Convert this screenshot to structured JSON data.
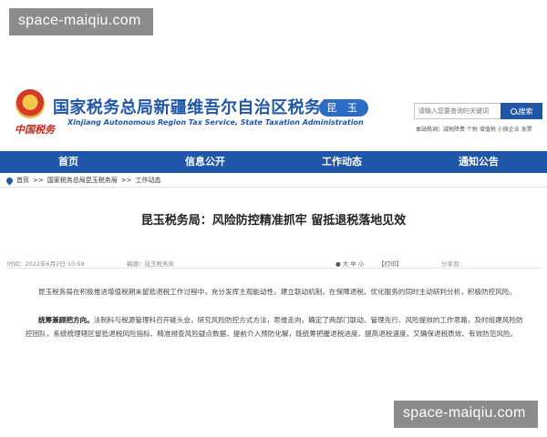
{
  "watermark": {
    "text": "space-maiqiu.com"
  },
  "header": {
    "brand_script": "中国税务",
    "title_cn": "国家税务总局新疆维吾尔自治区税务局",
    "title_en": "Xinjiang Autonomous Region Tax Service, State Taxation Administration",
    "region_badge": "昆 玉",
    "search": {
      "placeholder": "请输入您要查询的关键词",
      "button_label": "搜索"
    },
    "hot_words": {
      "label": "本站热词：",
      "items": "减税降费 个税 增值税 小微企业 发票"
    }
  },
  "nav": {
    "items": [
      "首页",
      "信息公开",
      "工作动态",
      "通知公告"
    ]
  },
  "breadcrumb": {
    "items": [
      "首页",
      ">>",
      "国家税务总局昆玉税务局",
      ">>",
      "工作动态"
    ]
  },
  "article": {
    "title": "昆玉税务局：风险防控精准抓牢 留抵退税落地见效",
    "meta": {
      "time": "时间：2022年6月2日 10:59",
      "source": "稿源：昆玉税务局",
      "font_controls": "● 大 中 小",
      "print": "【打印】",
      "share": "分享到："
    },
    "paragraphs": [
      {
        "lead": "",
        "text": "昆玉税务局在积极推进增值税期末留抵退税工作过程中，充分发挥主观能动性，建立联动机制，在保障退税、优化服务的同时主动研判分析，积极防控风险。"
      },
      {
        "lead": "统筹兼顾把方向。",
        "text": "法制科与税源管理科召开碰头会，研究风险防控方式方法，思维走向，确定了两部门联动、管理先行、风险提效的工作思路，及时组建风险防控团队，系统梳理辖区留抵退税风险指标、精准排查风险疑点数据、提前介入预防化解，既统筹把握退税进度、提高退税速度，又确保退税质效、有效防范风险。"
      }
    ]
  }
}
